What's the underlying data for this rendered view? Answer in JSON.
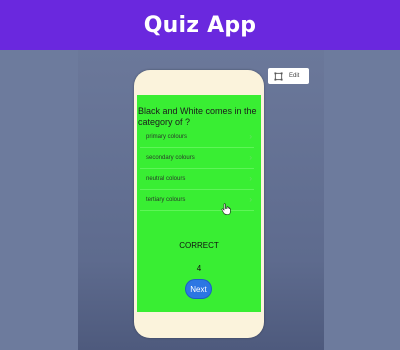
{
  "app": {
    "title": "Quiz App"
  },
  "edit_button": {
    "label": "Edit",
    "icon": "crop-frame-icon"
  },
  "quiz": {
    "question": "Black and White comes in the category of ?",
    "options": [
      {
        "label": "primary colours"
      },
      {
        "label": "secondary colours"
      },
      {
        "label": "neutral colours"
      },
      {
        "label": "tertiary colours"
      }
    ],
    "result": "CORRECT",
    "score": "4",
    "next_label": "Next"
  },
  "colors": {
    "header": "#6a28de",
    "background": "#6d7b9d",
    "screen": "#39ee33",
    "phone_frame": "#fbf3dc",
    "next_button": "#2c76e3"
  }
}
